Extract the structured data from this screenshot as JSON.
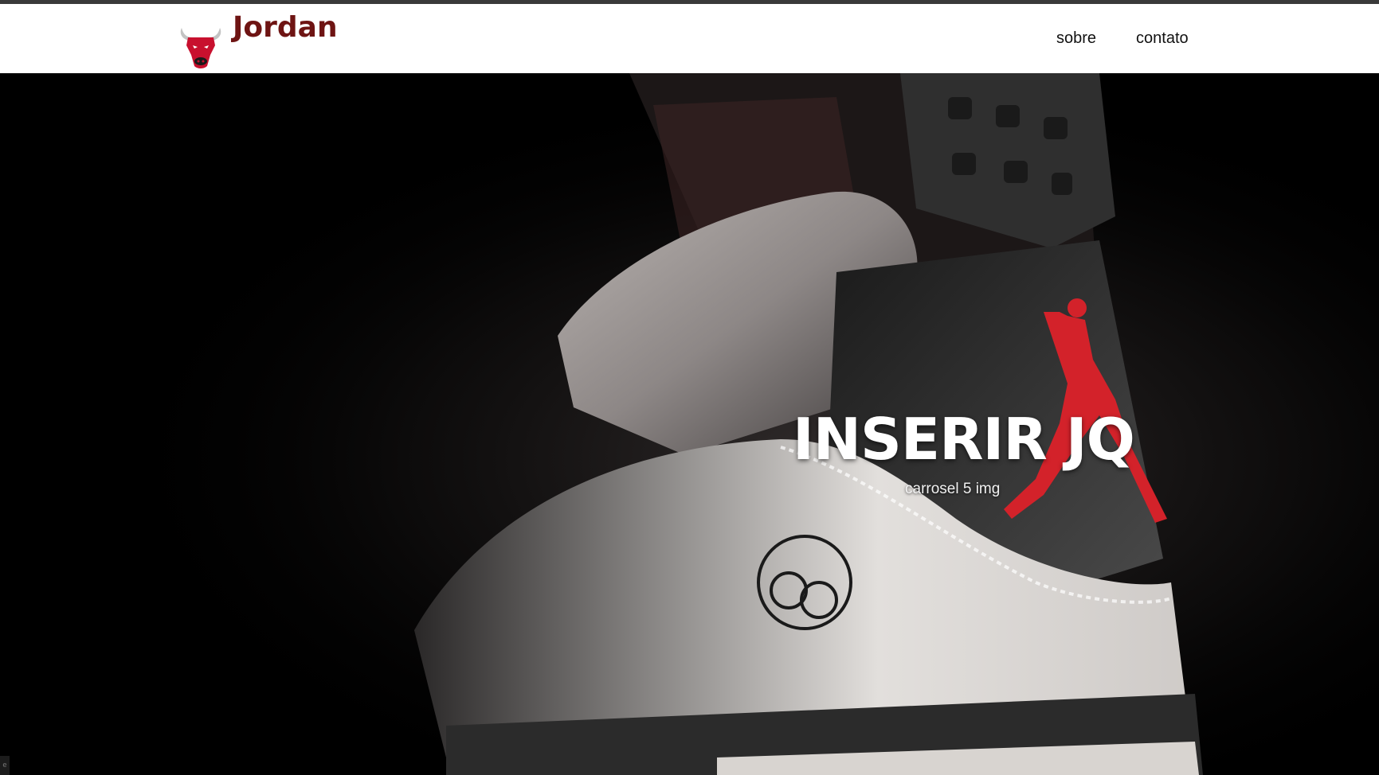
{
  "header": {
    "brand_text": "Jordan",
    "brand_logo_icon": "bull-head-icon",
    "nav": [
      {
        "label": "sobre"
      },
      {
        "label": "contato"
      }
    ]
  },
  "hero": {
    "title": "INSERIR JQ",
    "subtitle": "carrosel 5 img",
    "image_icon": "sneaker-hero-image"
  },
  "colors": {
    "brand": "#6e1413",
    "nav_text": "#111111",
    "hero_bg": "#000000",
    "accent_red": "#d3222a"
  }
}
